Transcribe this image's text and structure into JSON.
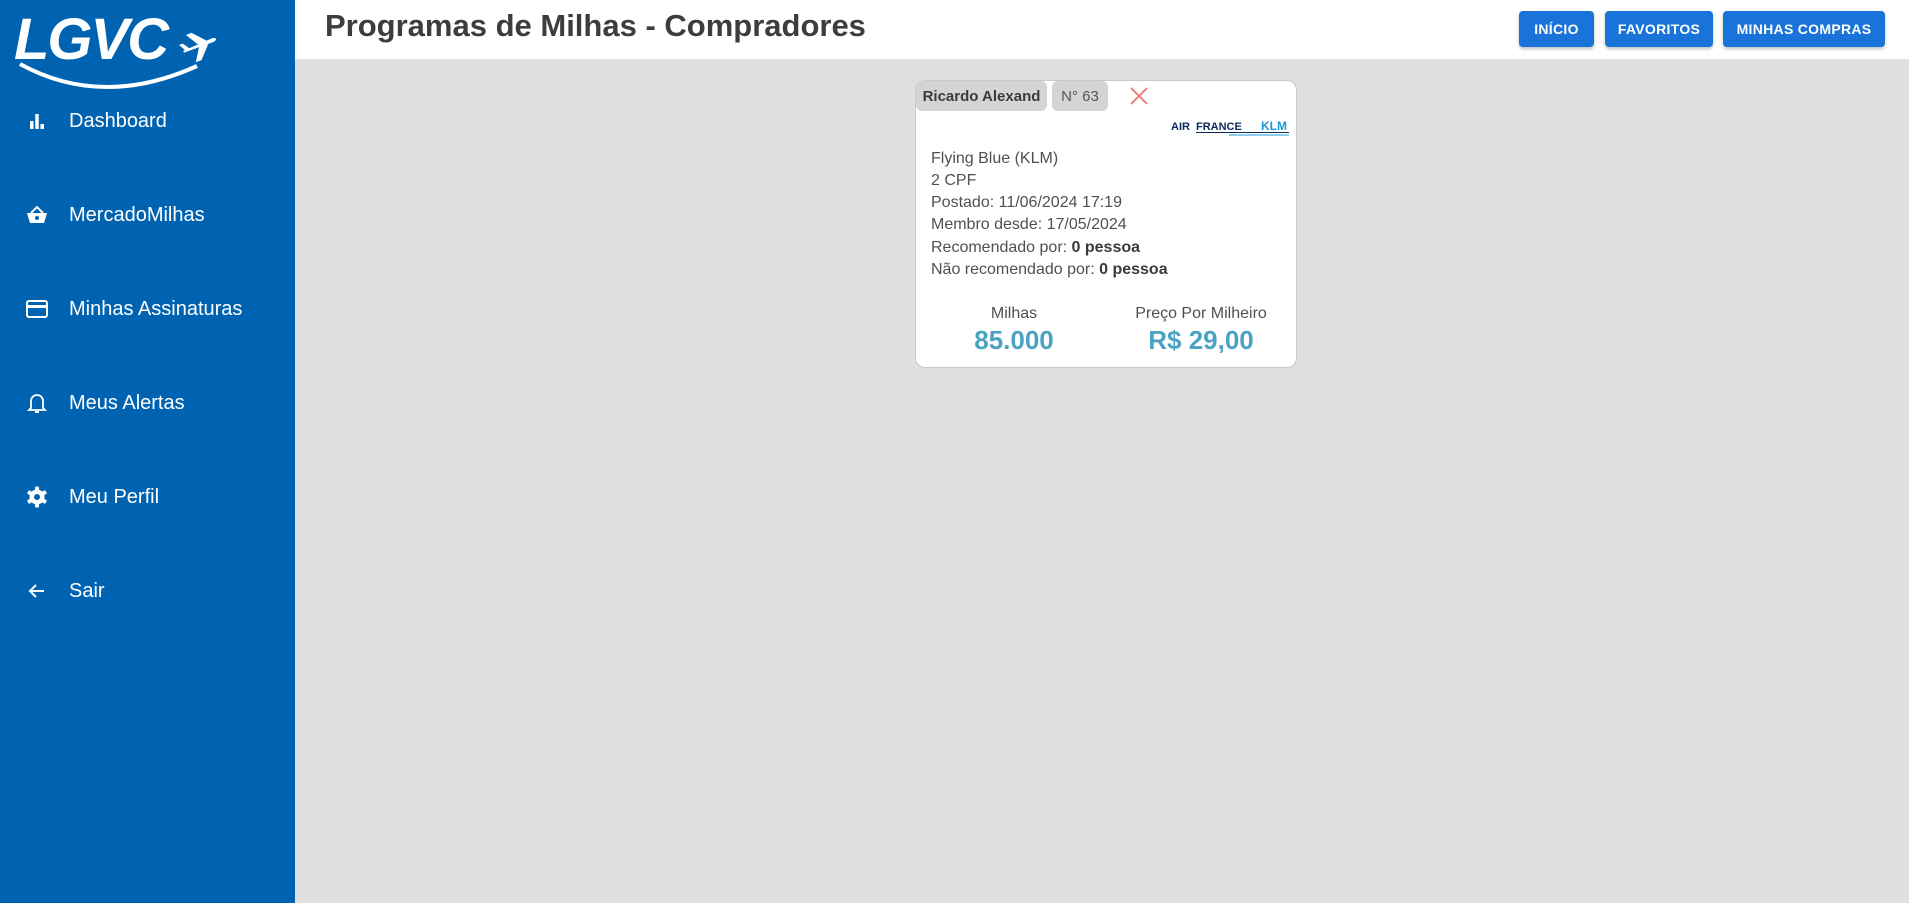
{
  "sidebar": {
    "logo_text": "LGVC",
    "items": [
      {
        "label": "Dashboard",
        "icon": "bar-chart-icon"
      },
      {
        "label": "MercadoMilhas",
        "icon": "basket-icon"
      },
      {
        "label": "Minhas Assinaturas",
        "icon": "credit-card-icon"
      },
      {
        "label": "Meus Alertas",
        "icon": "bell-icon"
      },
      {
        "label": "Meu Perfil",
        "icon": "gear-icon"
      },
      {
        "label": "Sair",
        "icon": "arrow-left-icon"
      }
    ]
  },
  "header": {
    "title": "Programas de Milhas - Compradores",
    "buttons": {
      "inicio": "INÍCIO",
      "favoritos": "FAVORITOS",
      "minhas_compras": "MINHAS COMPRAS"
    }
  },
  "card": {
    "user_name": "Ricardo Alexand",
    "number": "N° 63",
    "airline_logo_text": "AIR FRANCE KLM",
    "program": "Flying Blue (KLM)",
    "cpf": "2 CPF",
    "posted": "Postado: 11/06/2024 17:19",
    "member_since": "Membro desde: 17/05/2024",
    "recommended_label": "Recomendado por: ",
    "recommended_value": "0 pessoa",
    "not_recommended_label": "Não recomendado por: ",
    "not_recommended_value": "0 pessoa",
    "miles_label": "Milhas",
    "miles_value": "85.000",
    "price_label": "Preço Por Milheiro",
    "price_value": "R$ 29,00"
  },
  "colors": {
    "sidebar_bg": "#0063b2",
    "button_bg": "#1a73d8",
    "accent_value": "#4ba3c3",
    "close_icon": "#f08080",
    "page_bg": "#e0e0e0"
  }
}
